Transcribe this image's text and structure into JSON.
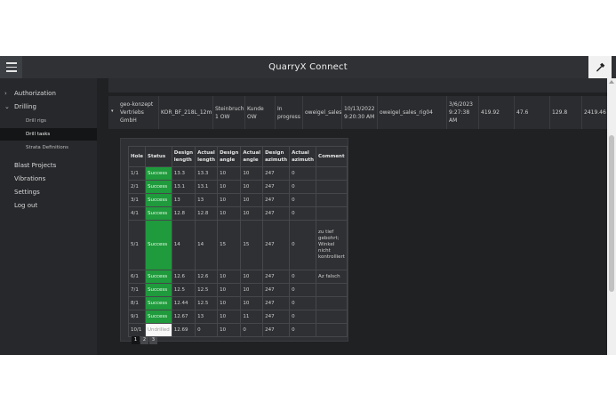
{
  "app": {
    "title": "QuarryX Connect",
    "menu_icon": "hamburger-icon",
    "tool_icon": "hammer-icon"
  },
  "sidebar": {
    "items": [
      {
        "label": "Authorization",
        "chevron": "›"
      },
      {
        "label": "Drilling",
        "chevron": "⌄"
      },
      {
        "label": "Drill rigs"
      },
      {
        "label": "Drill tasks"
      },
      {
        "label": "Strata Definitions"
      },
      {
        "label": "Blast Projects"
      },
      {
        "label": "Vibrations"
      },
      {
        "label": "Settings"
      },
      {
        "label": "Log out"
      }
    ]
  },
  "summary": {
    "caret": "▾",
    "company": "geo-konzept Vertriebs GmbH",
    "task": "KOR_BF_218L_12m",
    "site": "Steinbruch 1 OW",
    "customer": "Kunde OW",
    "status": "In progress",
    "user": "oweigel_sales",
    "created": "10/13/2022 9:20:30 AM",
    "rig": "oweigel_sales_rig04",
    "updated": "3/6/2023 9:27:38 AM",
    "v1": "419.92",
    "v2": "47.6",
    "v3": "129.8",
    "v4": "2419.46"
  },
  "holes_table": {
    "headers": [
      "Hole",
      "Status",
      "Design length",
      "Actual length",
      "Design angle",
      "Actual angle",
      "Design azimuth",
      "Actual azimuth",
      "Comment"
    ],
    "rows": [
      [
        "1/1",
        "Success",
        "13.3",
        "13.3",
        "10",
        "10",
        "247",
        "0",
        ""
      ],
      [
        "2/1",
        "Success",
        "13.1",
        "13.1",
        "10",
        "10",
        "247",
        "0",
        ""
      ],
      [
        "3/1",
        "Success",
        "13",
        "13",
        "10",
        "10",
        "247",
        "0",
        ""
      ],
      [
        "4/1",
        "Success",
        "12.8",
        "12.8",
        "10",
        "10",
        "247",
        "0",
        ""
      ],
      [
        "5/1",
        "Success",
        "14",
        "14",
        "15",
        "15",
        "247",
        "0",
        "zu tief gebohrt; Winkel nicht kontrolliert"
      ],
      [
        "6/1",
        "Success",
        "12.6",
        "12.6",
        "10",
        "10",
        "247",
        "0",
        "Az falsch"
      ],
      [
        "7/1",
        "Success",
        "12.5",
        "12.5",
        "10",
        "10",
        "247",
        "0",
        ""
      ],
      [
        "8/1",
        "Success",
        "12.44",
        "12.5",
        "10",
        "10",
        "247",
        "0",
        ""
      ],
      [
        "9/1",
        "Success",
        "12.67",
        "13",
        "10",
        "11",
        "247",
        "0",
        ""
      ],
      [
        "10/1",
        "Undrilled",
        "12.69",
        "0",
        "10",
        "0",
        "247",
        "0",
        ""
      ]
    ]
  },
  "pagination": {
    "pages": [
      "1",
      "2",
      "3"
    ],
    "current": "1"
  },
  "colors": {
    "success": "#1f9a3c",
    "undrilled": "#f8f8f8",
    "active_nav": "#141516",
    "header": "#2f3134"
  }
}
